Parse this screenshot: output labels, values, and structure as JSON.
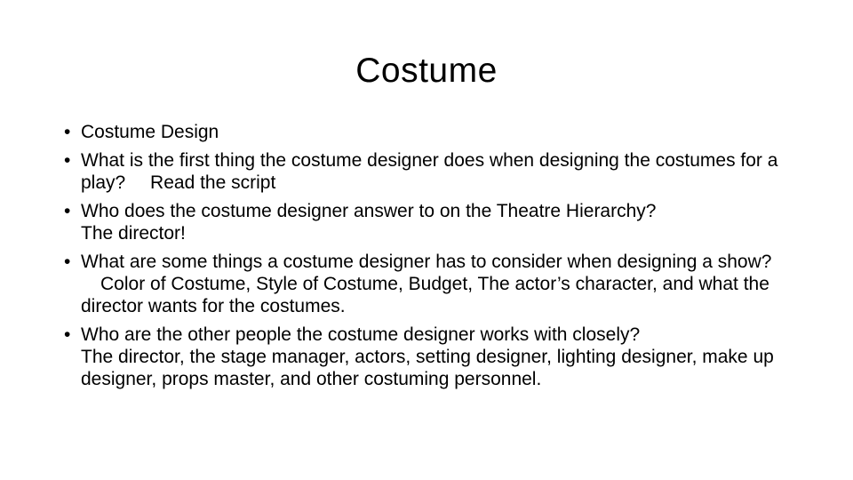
{
  "slide": {
    "title": "Costume",
    "bullet_symbol": "•",
    "items": [
      {
        "question": "Costume Design",
        "answer": ""
      },
      {
        "question": "What is the first thing the costume designer does when designing the costumes for a play?",
        "answer": "Read the script"
      },
      {
        "question": "Who does the costume designer answer to on the Theatre Hierarchy?",
        "answer": "The director!"
      },
      {
        "question": "What are some things a costume designer has to consider when designing a show?",
        "answer": "Color of Costume, Style of Costume, Budget, The actor’s character, and what the director wants for the costumes."
      },
      {
        "question": "Who are the other people the costume designer works with closely?",
        "answer": "The director, the stage manager, actors, setting designer, lighting designer, make up designer, props master, and other costuming personnel."
      }
    ]
  }
}
